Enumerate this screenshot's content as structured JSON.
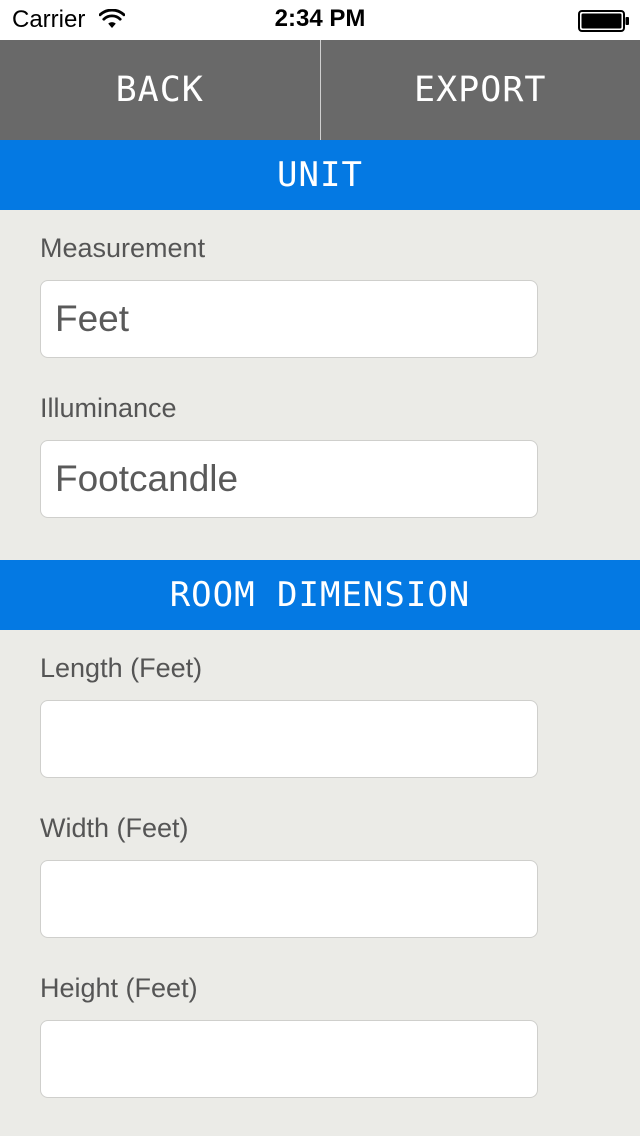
{
  "status_bar": {
    "carrier": "Carrier",
    "time": "2:34 PM"
  },
  "toolbar": {
    "back_label": "BACK",
    "export_label": "EXPORT"
  },
  "unit_section": {
    "title": "UNIT",
    "measurement_label": "Measurement",
    "measurement_value": "Feet",
    "illuminance_label": "Illuminance",
    "illuminance_value": "Footcandle"
  },
  "room_section": {
    "title": "ROOM DIMENSION",
    "length_label": "Length (Feet)",
    "length_value": "",
    "width_label": "Width (Feet)",
    "width_value": "",
    "height_label": "Height (Feet)",
    "height_value": ""
  },
  "icons": {
    "wifi": "wifi-icon",
    "battery": "battery-icon"
  },
  "colors": {
    "toolbar_bg": "#696969",
    "section_header_bg": "#0479e3",
    "page_bg": "#ebebe7"
  }
}
